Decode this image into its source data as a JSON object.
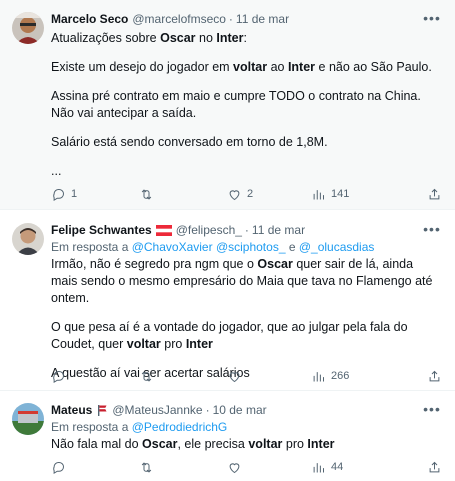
{
  "tweets": [
    {
      "name": "Marcelo Seco",
      "handle": "@marcelofmseco",
      "sep": "·",
      "date": "11 de mar",
      "line1_pre": "Atualizações sobre ",
      "line1_oscar": "Oscar",
      "line1_mid": " no ",
      "line1_inter": "Inter",
      "line1_post": ":",
      "p2_pre": "Existe um desejo do jogador em ",
      "p2_voltar": "voltar",
      "p2_mid": " ao ",
      "p2_inter": "Inter",
      "p2_post": " e não ao São Paulo.",
      "p3": "Assina pré contrato em maio e cumpre TODO o contrato na China. Não vai antecipar a saída.",
      "p4": "Salário está sendo conversado em torno de 1,8M.",
      "p5": "...",
      "replies": "1",
      "retweets": "",
      "likes": "2",
      "views": "141"
    },
    {
      "name": "Felipe Schwantes",
      "handle": "@felipesch_",
      "sep": "·",
      "date": "11 de mar",
      "reply_prefix": "Em resposta a ",
      "reply_m1": "@ChavoXavier",
      "reply_m2": "@sciphotos_",
      "reply_and": " e ",
      "reply_m3": "@_olucasdias",
      "p1_pre": "Irmão, não é segredo pra ngm que o ",
      "p1_oscar": "Oscar",
      "p1_post": " quer sair de lá, ainda mais sendo o mesmo empresário do Maia que tava no Flamengo até ontem.",
      "p2_pre": "O que pesa aí é a vontade do jogador, que ao julgar pela fala do Coudet, quer ",
      "p2_voltar": "voltar",
      "p2_mid": " pro ",
      "p2_inter": "Inter",
      "p3": "A questão aí vai ser acertar salários",
      "replies": "",
      "retweets": "",
      "likes": "",
      "views": "266"
    },
    {
      "name": "Mateus",
      "handle": "@MateusJannke",
      "sep": "·",
      "date": "10 de mar",
      "reply_prefix": "Em resposta a ",
      "reply_m1": "@PedrodiedrichG",
      "p1_pre": "Não fala mal do ",
      "p1_oscar": "Oscar",
      "p1_mid": ", ele precisa ",
      "p1_voltar": "voltar",
      "p1_mid2": " pro ",
      "p1_inter": "Inter",
      "replies": "",
      "retweets": "",
      "likes": "",
      "views": "44"
    }
  ],
  "icons": {
    "more": "more-horizontal-icon",
    "reply": "reply-icon",
    "retweet": "retweet-icon",
    "like": "heart-icon",
    "views": "views-icon",
    "share": "share-icon"
  },
  "colors": {
    "text": "#0f1419",
    "secondary": "#536471",
    "link": "#1d9bf0",
    "highlight_bg": "#f7f9f9"
  }
}
